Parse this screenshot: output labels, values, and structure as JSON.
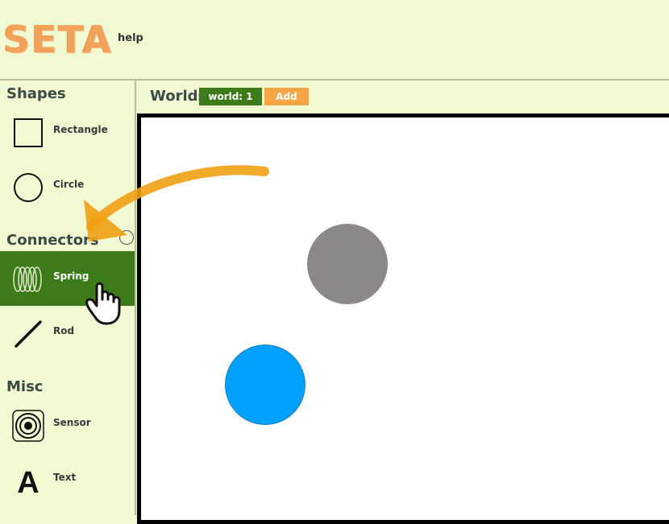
{
  "header": {
    "logo_text": "SETA",
    "help_label": "help"
  },
  "sidebar": {
    "sections": {
      "shapes": "Shapes",
      "connectors": "Connectors",
      "misc": "Misc"
    },
    "tools": {
      "rectangle": "Rectangle",
      "circle": "Circle",
      "spring": "Spring",
      "rod": "Rod",
      "sensor": "Sensor",
      "text": "Text"
    },
    "active_tool": "spring",
    "text_icon_glyph": "A"
  },
  "worlds": {
    "label": "Worlds",
    "tabs": [
      "world: 1"
    ],
    "add_label": "Add"
  },
  "canvas": {
    "bodies": [
      {
        "shape": "circle",
        "color": "#8e8789"
      },
      {
        "shape": "circle",
        "color": "#00a0ff"
      }
    ]
  },
  "colors": {
    "background": "#f1f9d3",
    "accent_green": "#3d7a1a",
    "accent_orange": "#f4a545",
    "logo_orange": "#f2a25a"
  },
  "icons": [
    "rectangle-icon",
    "circle-icon",
    "spring-icon",
    "rod-icon",
    "sensor-icon",
    "text-icon",
    "hand-pointer-icon",
    "arrow-annotation"
  ]
}
